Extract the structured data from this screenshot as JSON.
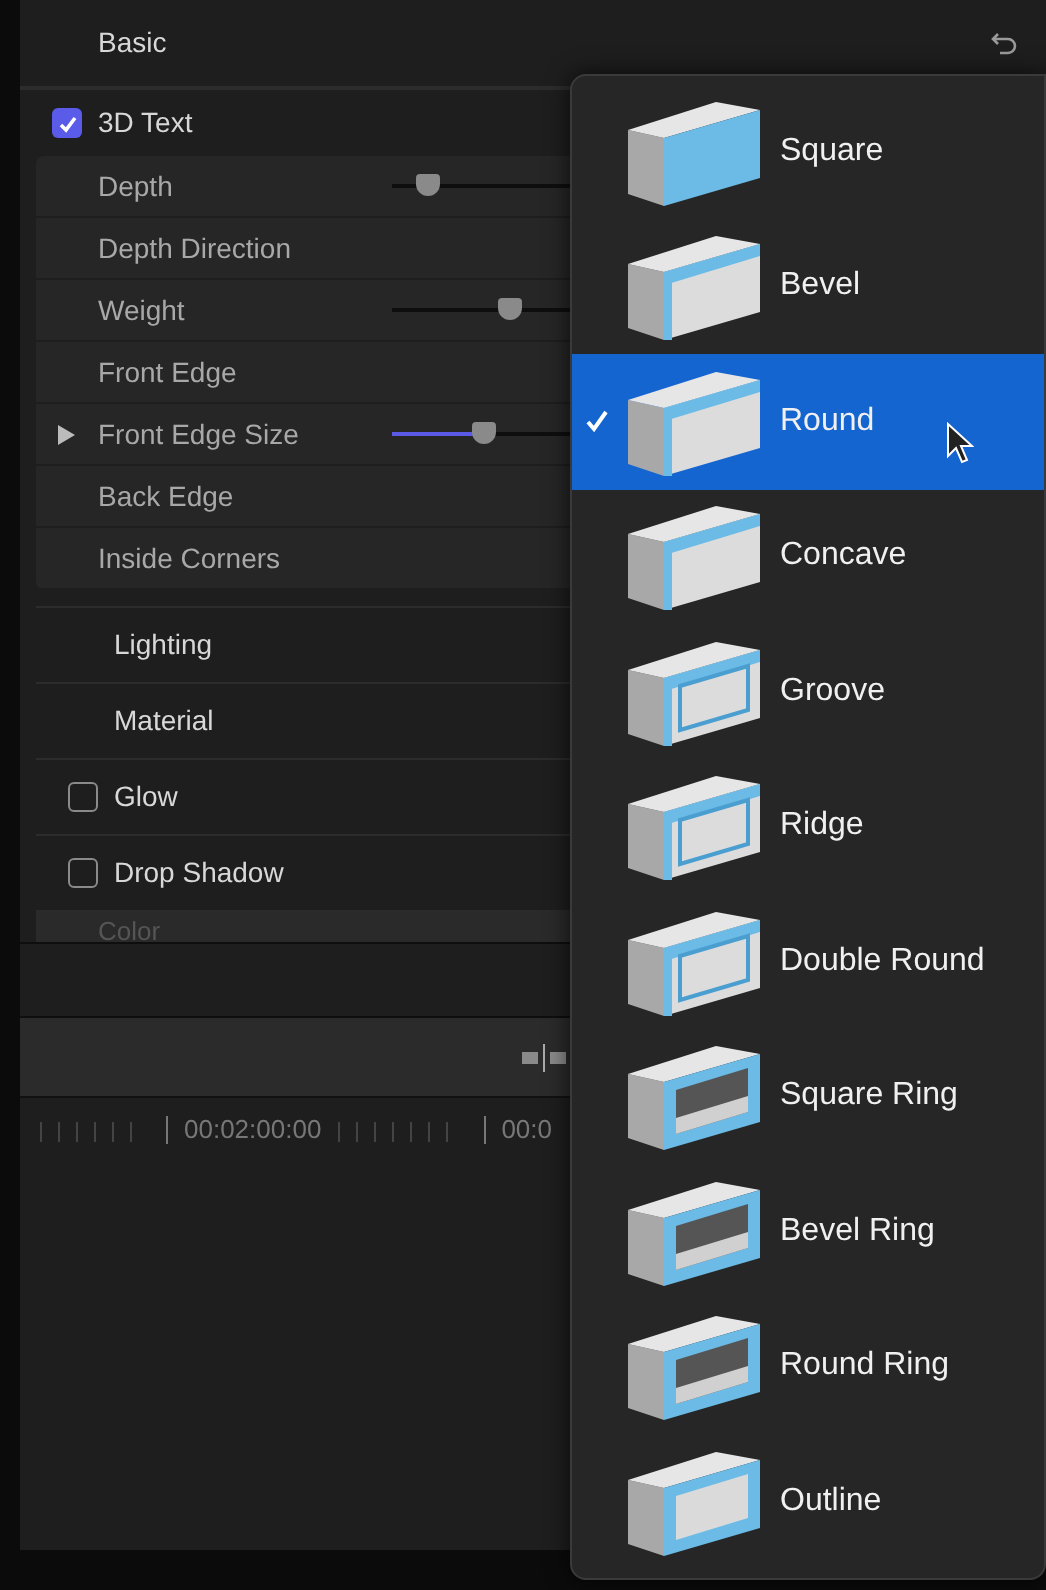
{
  "header": {
    "title": "Basic"
  },
  "section": {
    "label": "3D Text",
    "checked": true
  },
  "rows": [
    {
      "label": "Depth",
      "kind": "slider",
      "level": 0.1,
      "active": false
    },
    {
      "label": "Depth Direction",
      "kind": "plain"
    },
    {
      "label": "Weight",
      "kind": "slider",
      "level": 0.33,
      "active": false
    },
    {
      "label": "Front Edge",
      "kind": "plain"
    },
    {
      "label": "Front Edge Size",
      "kind": "slider",
      "level": 0.26,
      "active": true,
      "expanded": false
    },
    {
      "label": "Back Edge",
      "kind": "plain"
    },
    {
      "label": "Inside Corners",
      "kind": "plain"
    }
  ],
  "groups": [
    {
      "label": "Lighting",
      "kind": "heading"
    },
    {
      "label": "Material",
      "kind": "heading"
    },
    {
      "label": "Glow",
      "kind": "checkbox",
      "checked": false
    },
    {
      "label": "Drop Shadow",
      "kind": "checkbox",
      "checked": false
    }
  ],
  "faded_row": {
    "label": "Color"
  },
  "timeline": {
    "timecodes": [
      "00:02:00:00",
      "00:0"
    ]
  },
  "menu": [
    {
      "label": "Square",
      "selected": false
    },
    {
      "label": "Bevel",
      "selected": false
    },
    {
      "label": "Round",
      "selected": true
    },
    {
      "label": "Concave",
      "selected": false
    },
    {
      "label": "Groove",
      "selected": false
    },
    {
      "label": "Ridge",
      "selected": false
    },
    {
      "label": "Double Round",
      "selected": false
    },
    {
      "label": "Square Ring",
      "selected": false
    },
    {
      "label": "Bevel Ring",
      "selected": false
    },
    {
      "label": "Round Ring",
      "selected": false
    },
    {
      "label": "Outline",
      "selected": false
    }
  ]
}
